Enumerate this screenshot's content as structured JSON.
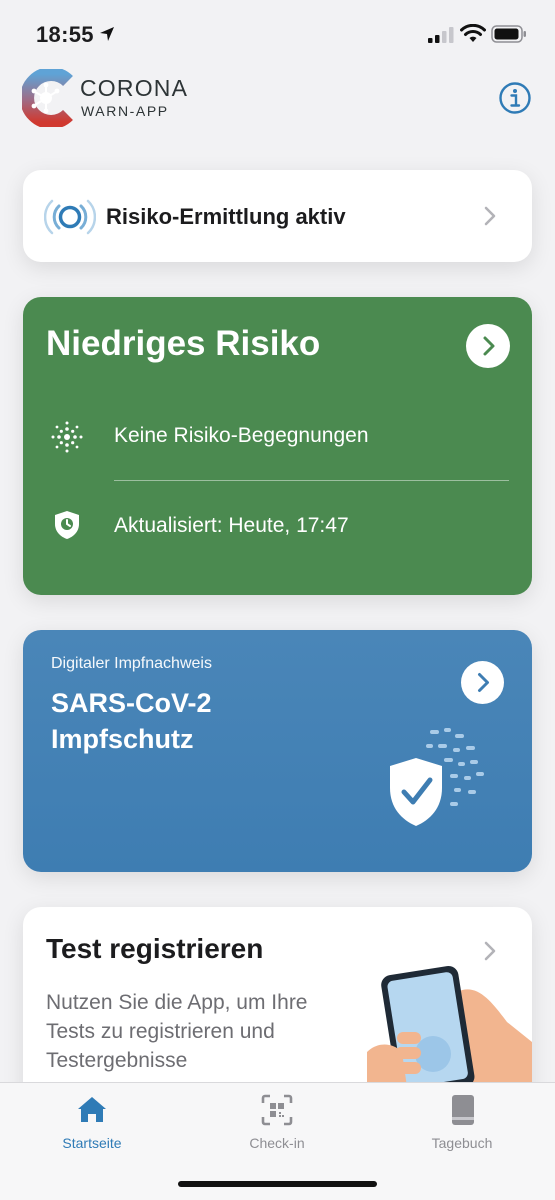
{
  "status_bar": {
    "time": "18:55",
    "icons": [
      "location-arrow-icon",
      "signal-icon",
      "wifi-icon",
      "battery-icon"
    ]
  },
  "header": {
    "logo_title": "CORONA",
    "logo_subtitle": "WARN-APP",
    "info_icon": "info-icon"
  },
  "risk_status_card": {
    "label": "Risiko-Ermittlung aktiv",
    "icon": "pulse-icon"
  },
  "risk_card": {
    "title": "Niedriges Risiko",
    "line1": "Keine Risiko-Begegnungen",
    "line2": "Aktualisiert: Heute, 17:47",
    "color": "#4b8a50"
  },
  "vaccination_card": {
    "subtitle": "Digitaler Impfnachweis",
    "title": "SARS-CoV-2 Impfschutz",
    "color": "#4a86b8"
  },
  "test_card": {
    "title": "Test registrieren",
    "body": "Nutzen Sie die App, um Ihre Tests zu registrieren und Testergebnisse"
  },
  "tab_bar": {
    "tabs": [
      {
        "label": "Startseite",
        "icon": "home-icon",
        "active": true
      },
      {
        "label": "Check-in",
        "icon": "qr-scan-icon",
        "active": false
      },
      {
        "label": "Tagebuch",
        "icon": "book-icon",
        "active": false
      }
    ],
    "accent_color": "#2f7bb6"
  }
}
